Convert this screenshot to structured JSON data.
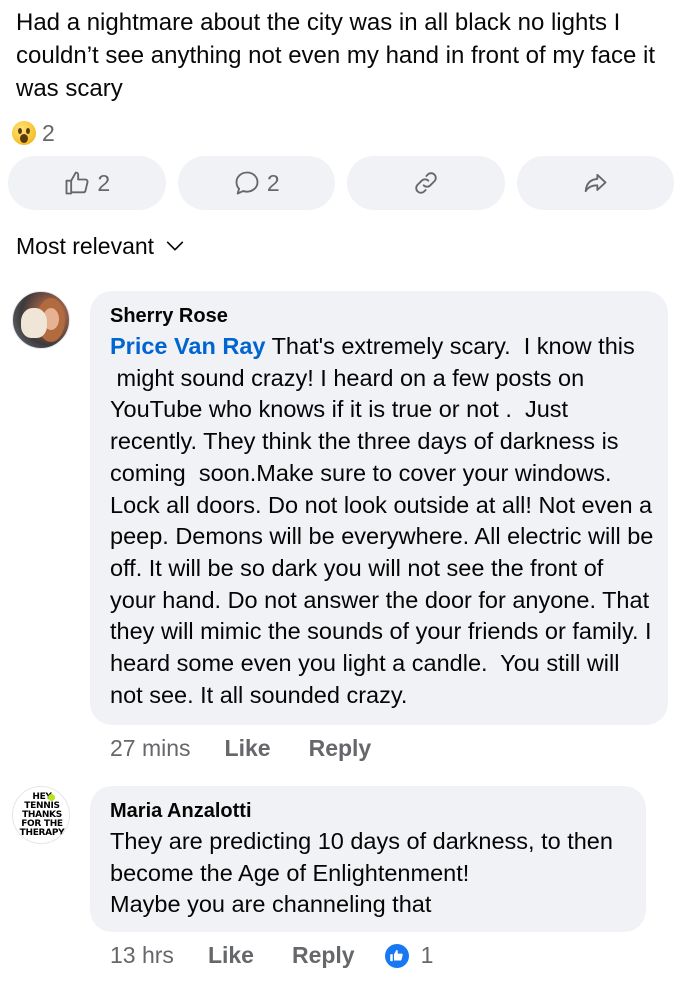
{
  "post": {
    "text": "Had a nightmare about the city was in all black no lights I couldn’t see anything not even my hand in front of my face it was scary",
    "reaction_icon": "wow-emoji",
    "reaction_count": "2"
  },
  "actions": {
    "like_count": "2",
    "comment_count": "2"
  },
  "sort": {
    "label": "Most relevant"
  },
  "comments": [
    {
      "author": "Sherry Rose",
      "mention": "Price Van Ray",
      "text": " That's extremely scary.  I know this\n might sound crazy! I heard on a few posts on YouTube who knows if it is true or not .  Just recently. They think the three days of darkness is coming  soon.Make sure to cover your windows. Lock all doors. Do not look outside at all! Not even a peep. Demons will be everywhere. All electric will be off. It will be so dark you will not see the front of your hand. Do not answer the door for anyone. That they will mimic the sounds of your friends or family. I heard some even you light a candle.  You still will not see. It all sounded crazy.",
      "time": "27 mins",
      "like_label": "Like",
      "reply_label": "Reply"
    },
    {
      "author": "Maria Anzalotti",
      "avatar_text": [
        "HEY",
        "TENNIS",
        "THANKS",
        "FOR THE",
        "THERAPY"
      ],
      "text": "They are predicting 10 days of darkness, to then become the Age of Enlightenment!\nMaybe you are channeling that",
      "time": "13 hrs",
      "like_label": "Like",
      "reply_label": "Reply",
      "reaction_count": "1"
    }
  ],
  "colors": {
    "mention": "#0064d1",
    "bubble": "#f0f2f5",
    "meta": "#65676b",
    "like_badge": "#1877f2"
  }
}
